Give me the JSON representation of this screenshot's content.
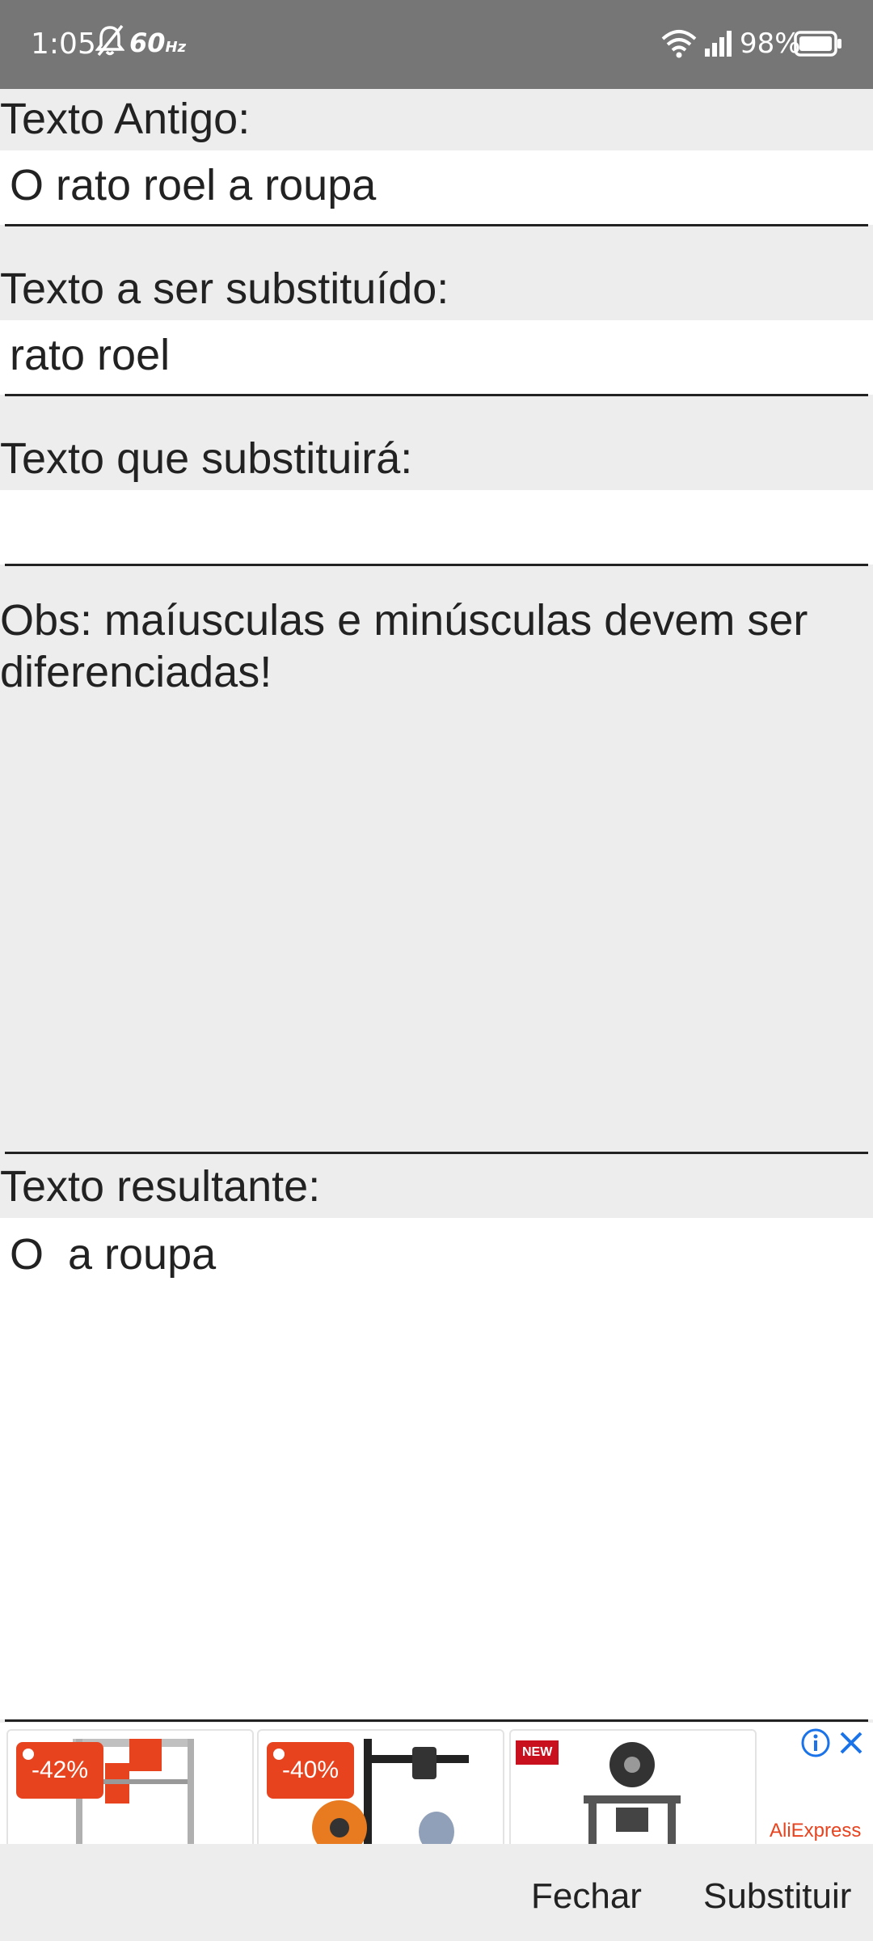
{
  "status_bar": {
    "time": "1:05",
    "refresh_rate": "60",
    "refresh_unit": "Hz",
    "battery": "98%",
    "icons": [
      "mute-icon",
      "wifi-icon",
      "signal-icon",
      "battery-icon"
    ]
  },
  "form": {
    "old_text_label": "Texto Antigo:",
    "old_text_value": "O rato roel a roupa",
    "to_replace_label": "Texto a ser substituído:",
    "to_replace_value": "rato roel",
    "replacement_label": "Texto que substituirá:",
    "replacement_value": "",
    "note": "Obs: maíusculas e minúsculas devem ser diferenciadas!",
    "result_label": "Texto resultante:",
    "result_value": "O  a roupa"
  },
  "ad": {
    "cards": [
      {
        "badge": "-42%"
      },
      {
        "badge": "-40%"
      },
      {
        "badge": "NEW"
      }
    ],
    "brand": "AliExpress",
    "icons": [
      "info-icon",
      "close-icon"
    ]
  },
  "actions": {
    "close_label": "Fechar",
    "replace_label": "Substituir"
  },
  "colors": {
    "status_bar": "#767676",
    "background": "#ededed",
    "ad_accent": "#e8431f",
    "info_blue": "#1a73e8"
  }
}
